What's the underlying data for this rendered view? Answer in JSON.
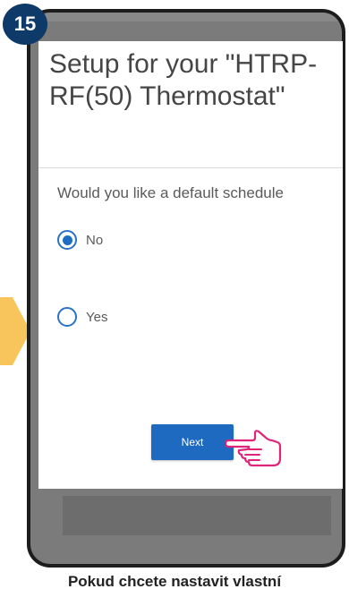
{
  "step_badge": {
    "number": "15"
  },
  "dialog": {
    "title": "Setup for your \"HTRP-RF(50) Thermostat\"",
    "question": "Would you like a default schedule",
    "options": [
      {
        "label": "No",
        "selected": true
      },
      {
        "label": "Yes",
        "selected": false
      }
    ],
    "next_label": "Next"
  },
  "caption": {
    "text": "Pokud chcete nastavit vlastní"
  },
  "colors": {
    "badge": "#0d3a68",
    "arrow": "#f8c45c",
    "primary": "#1d6ac0",
    "hand_outline": "#e0247a"
  },
  "icons": {
    "arrow": "arrow-right-icon",
    "hand": "pointing-hand-icon"
  }
}
